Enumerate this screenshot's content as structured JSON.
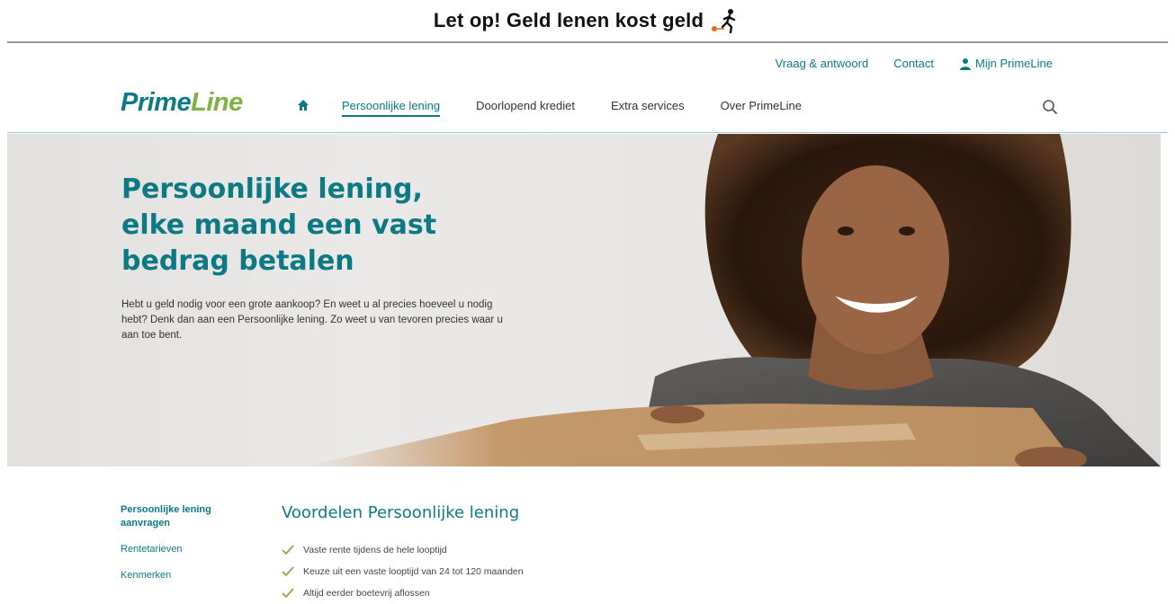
{
  "warning": {
    "text": "Let op! Geld lenen kost geld",
    "icon": "running-man-with-ball-and-chain-icon"
  },
  "top_links": [
    {
      "label": "Vraag & antwoord"
    },
    {
      "label": "Contact"
    },
    {
      "label": "Mijn PrimeLine",
      "icon": "user-icon"
    }
  ],
  "nav": {
    "logo_part1": "Prime",
    "logo_part2": "Line",
    "items": [
      {
        "label": "Persoonlijke lening",
        "active": true
      },
      {
        "label": "Doorlopend krediet"
      },
      {
        "label": "Extra services"
      },
      {
        "label": "Over PrimeLine"
      }
    ]
  },
  "hero": {
    "title_line1": "Persoonlijke lening,",
    "title_line2": "elke maand een vast",
    "title_line3": "bedrag betalen",
    "body": "Hebt u geld nodig voor een grote aankoop? En weet u al precies hoeveel u nodig hebt? Denk dan aan een Persoonlijke lening. Zo weet u van tevoren precies waar u aan toe bent."
  },
  "side_nav": {
    "items": [
      {
        "label": "Persoonlijke lening aanvragen"
      },
      {
        "label": "Rentetarieven"
      },
      {
        "label": "Kenmerken"
      }
    ]
  },
  "main": {
    "title": "Voordelen Persoonlijke lening",
    "benefits": [
      "Vaste rente tijdens de hele looptijd",
      "Keuze uit een vaste looptijd van 24 tot 120 maanden",
      "Altijd eerder boetevrij aflossen"
    ]
  },
  "colors": {
    "brand_teal": "#0b7a85",
    "brand_green": "#7cb342",
    "check_green": "#7cb342"
  }
}
